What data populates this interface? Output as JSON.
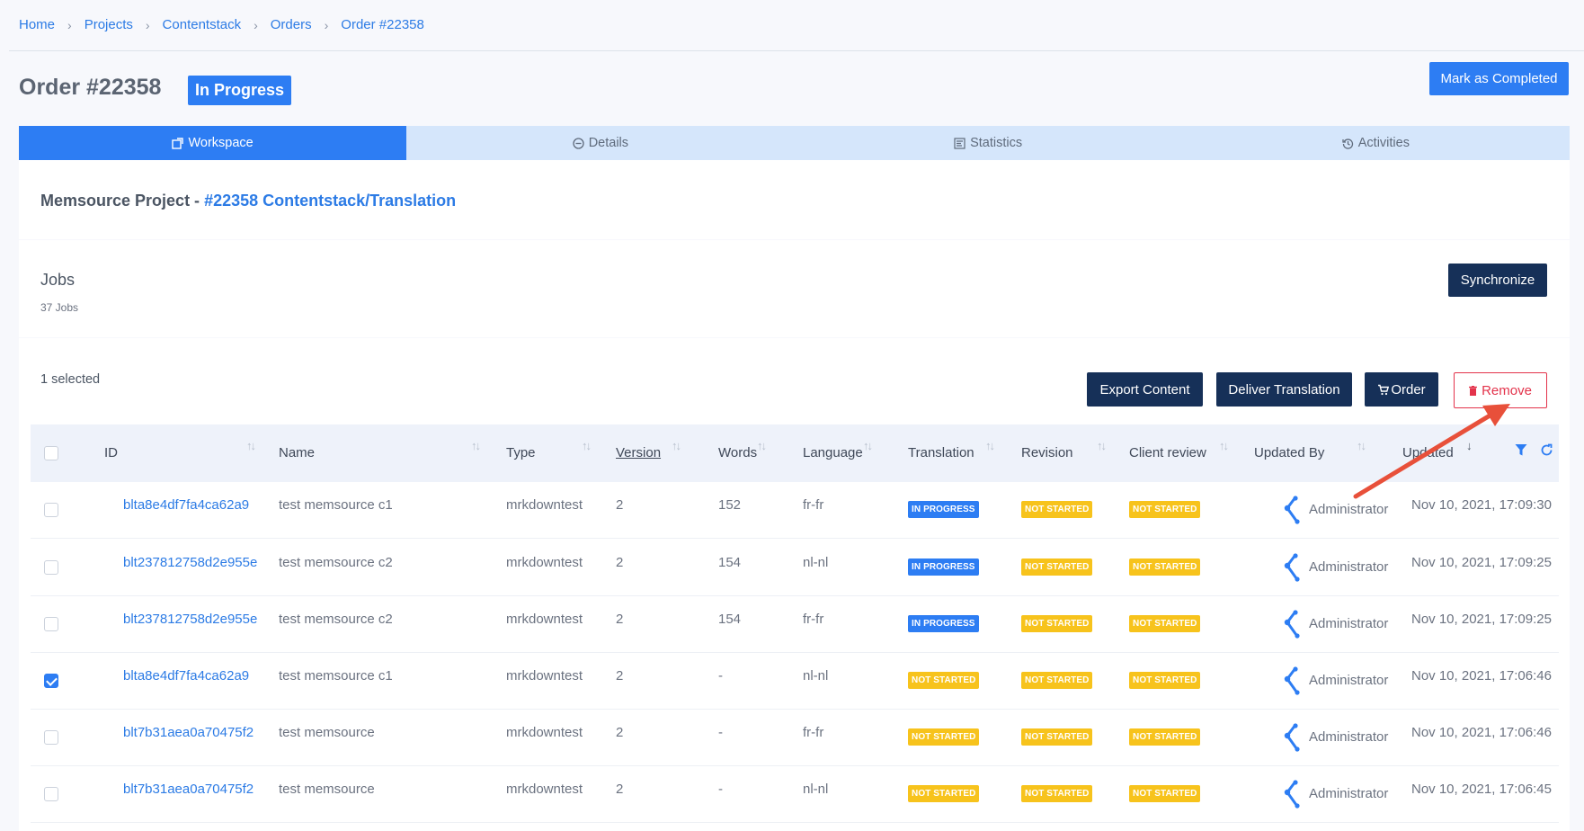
{
  "breadcrumb": [
    "Home",
    "Projects",
    "Contentstack",
    "Orders",
    "Order #22358"
  ],
  "page": {
    "title": "Order #22358",
    "status": "In Progress",
    "mark_completed_label": "Mark as Completed"
  },
  "tabs": [
    {
      "label": "Workspace",
      "icon": "workspace-icon"
    },
    {
      "label": "Details",
      "icon": "details-icon"
    },
    {
      "label": "Statistics",
      "icon": "statistics-icon"
    },
    {
      "label": "Activities",
      "icon": "history-icon"
    }
  ],
  "project": {
    "prefix": "Memsource Project - ",
    "link": "#22358 Contentstack/Translation"
  },
  "jobs": {
    "title": "Jobs",
    "count": "37 Jobs",
    "synchronize_label": "Synchronize"
  },
  "toolbar": {
    "selected": "1 selected",
    "export_label": "Export Content",
    "deliver_label": "Deliver Translation",
    "order_label": "Order",
    "remove_label": "Remove"
  },
  "table": {
    "columns": [
      "ID",
      "Name",
      "Type",
      "Version",
      "Words",
      "Language",
      "Translation",
      "Revision",
      "Client review",
      "Updated By",
      "Updated"
    ],
    "rows": [
      {
        "checked": false,
        "id": "blta8e4df7fa4ca62a9",
        "name": "test memsource c1",
        "type": "mrkdowntest",
        "version": "2",
        "words": "152",
        "language": "fr-fr",
        "translation": "IN PROGRESS",
        "revision": "NOT STARTED",
        "client_review": "NOT STARTED",
        "updated_by": "Administrator",
        "updated": "Nov 10, 2021, 17:09:30"
      },
      {
        "checked": false,
        "id": "blt237812758d2e955e",
        "name": "test memsource c2",
        "type": "mrkdowntest",
        "version": "2",
        "words": "154",
        "language": "nl-nl",
        "translation": "IN PROGRESS",
        "revision": "NOT STARTED",
        "client_review": "NOT STARTED",
        "updated_by": "Administrator",
        "updated": "Nov 10, 2021, 17:09:25"
      },
      {
        "checked": false,
        "id": "blt237812758d2e955e",
        "name": "test memsource c2",
        "type": "mrkdowntest",
        "version": "2",
        "words": "154",
        "language": "fr-fr",
        "translation": "IN PROGRESS",
        "revision": "NOT STARTED",
        "client_review": "NOT STARTED",
        "updated_by": "Administrator",
        "updated": "Nov 10, 2021, 17:09:25"
      },
      {
        "checked": true,
        "id": "blta8e4df7fa4ca62a9",
        "name": "test memsource c1",
        "type": "mrkdowntest",
        "version": "2",
        "words": "-",
        "language": "nl-nl",
        "translation": "NOT STARTED",
        "revision": "NOT STARTED",
        "client_review": "NOT STARTED",
        "updated_by": "Administrator",
        "updated": "Nov 10, 2021, 17:06:46"
      },
      {
        "checked": false,
        "id": "blt7b31aea0a70475f2",
        "name": "test memsource",
        "type": "mrkdowntest",
        "version": "2",
        "words": "-",
        "language": "fr-fr",
        "translation": "NOT STARTED",
        "revision": "NOT STARTED",
        "client_review": "NOT STARTED",
        "updated_by": "Administrator",
        "updated": "Nov 10, 2021, 17:06:46"
      },
      {
        "checked": false,
        "id": "blt7b31aea0a70475f2",
        "name": "test memsource",
        "type": "mrkdowntest",
        "version": "2",
        "words": "-",
        "language": "nl-nl",
        "translation": "NOT STARTED",
        "revision": "NOT STARTED",
        "client_review": "NOT STARTED",
        "updated_by": "Administrator",
        "updated": "Nov 10, 2021, 17:06:45"
      }
    ]
  },
  "colors": {
    "accent": "#2d7df3",
    "dark_button": "#163058",
    "danger": "#e3334b",
    "badge_yellow": "#f7c31c",
    "annotation_arrow": "#e8503a"
  }
}
